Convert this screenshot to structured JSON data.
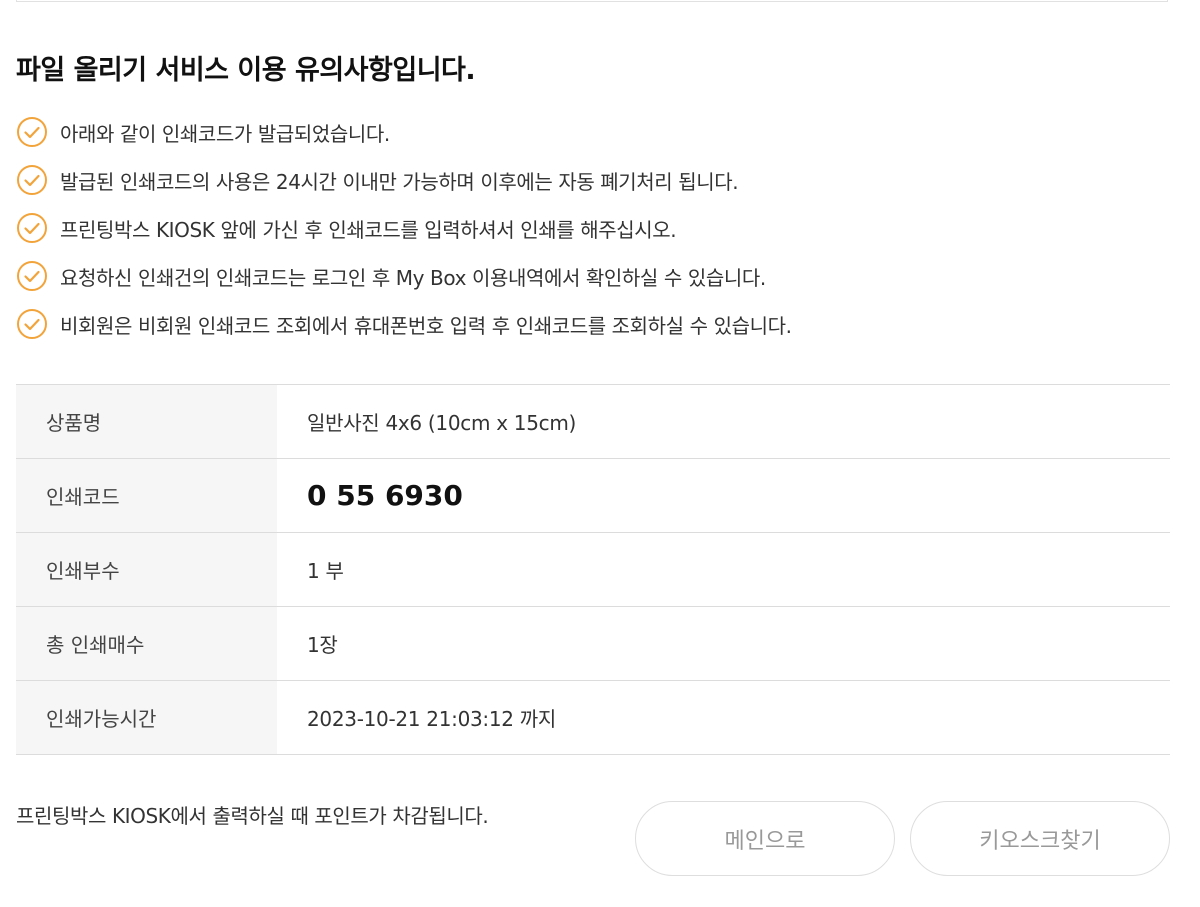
{
  "title": "파일 올리기 서비스 이용 유의사항입니다.",
  "notices": [
    "아래와 같이 인쇄코드가 발급되었습니다.",
    "발급된 인쇄코드의 사용은 24시간 이내만 가능하며 이후에는 자동 폐기처리 됩니다.",
    "프린팅박스 KIOSK 앞에 가신 후 인쇄코드를 입력하셔서 인쇄를 해주십시오.",
    "요청하신 인쇄건의 인쇄코드는 로그인 후 My Box 이용내역에서 확인하실 수 있습니다.",
    "비회원은 비회원 인쇄코드 조회에서 휴대폰번호 입력 후 인쇄코드를 조회하실 수 있습니다."
  ],
  "check_icon": "check-circle-icon",
  "colors": {
    "accent": "#f2a43a",
    "header_bg": "#f6f6f6",
    "border": "#dcdcdc"
  },
  "details": [
    {
      "label": "상품명",
      "value": "일반사진 4x6 (10cm x 15cm)"
    },
    {
      "label": "인쇄코드",
      "value": "0 55 6930"
    },
    {
      "label": "인쇄부수",
      "value": "1 부"
    },
    {
      "label": "총 인쇄매수",
      "value": "1장"
    },
    {
      "label": "인쇄가능시간",
      "value": "2023-10-21 21:03:12 까지"
    }
  ],
  "footer_note": "프린팅박스 KIOSK에서 출력하실 때 포인트가 차감됩니다.",
  "buttons": {
    "main": "메인으로",
    "find_kiosk": "키오스크찾기"
  }
}
